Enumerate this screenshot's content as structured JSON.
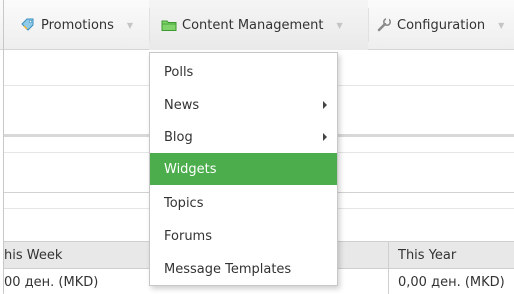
{
  "menubar": {
    "promotions": "Promotions",
    "content_management": "Content Management",
    "configuration": "Configuration"
  },
  "dropdown": {
    "items": [
      {
        "label": "Polls",
        "has_submenu": false
      },
      {
        "label": "News",
        "has_submenu": true
      },
      {
        "label": "Blog",
        "has_submenu": true
      },
      {
        "label": "Widgets",
        "has_submenu": false,
        "active": true
      },
      {
        "label": "Topics",
        "has_submenu": false
      },
      {
        "label": "Forums",
        "has_submenu": false
      },
      {
        "label": "Message Templates",
        "has_submenu": false
      }
    ]
  },
  "stats_table": {
    "headers": [
      "his Week",
      "This Year"
    ],
    "row": [
      "00 ден. (MKD)",
      "0,00 ден. (MKD)"
    ]
  },
  "colors": {
    "active_item_bg": "#4cad4c",
    "menubar_bg": "#f0f0f0"
  },
  "icons": {
    "promotions": "tag-icon",
    "content_management": "folder-icon",
    "configuration": "wrench-icon"
  }
}
